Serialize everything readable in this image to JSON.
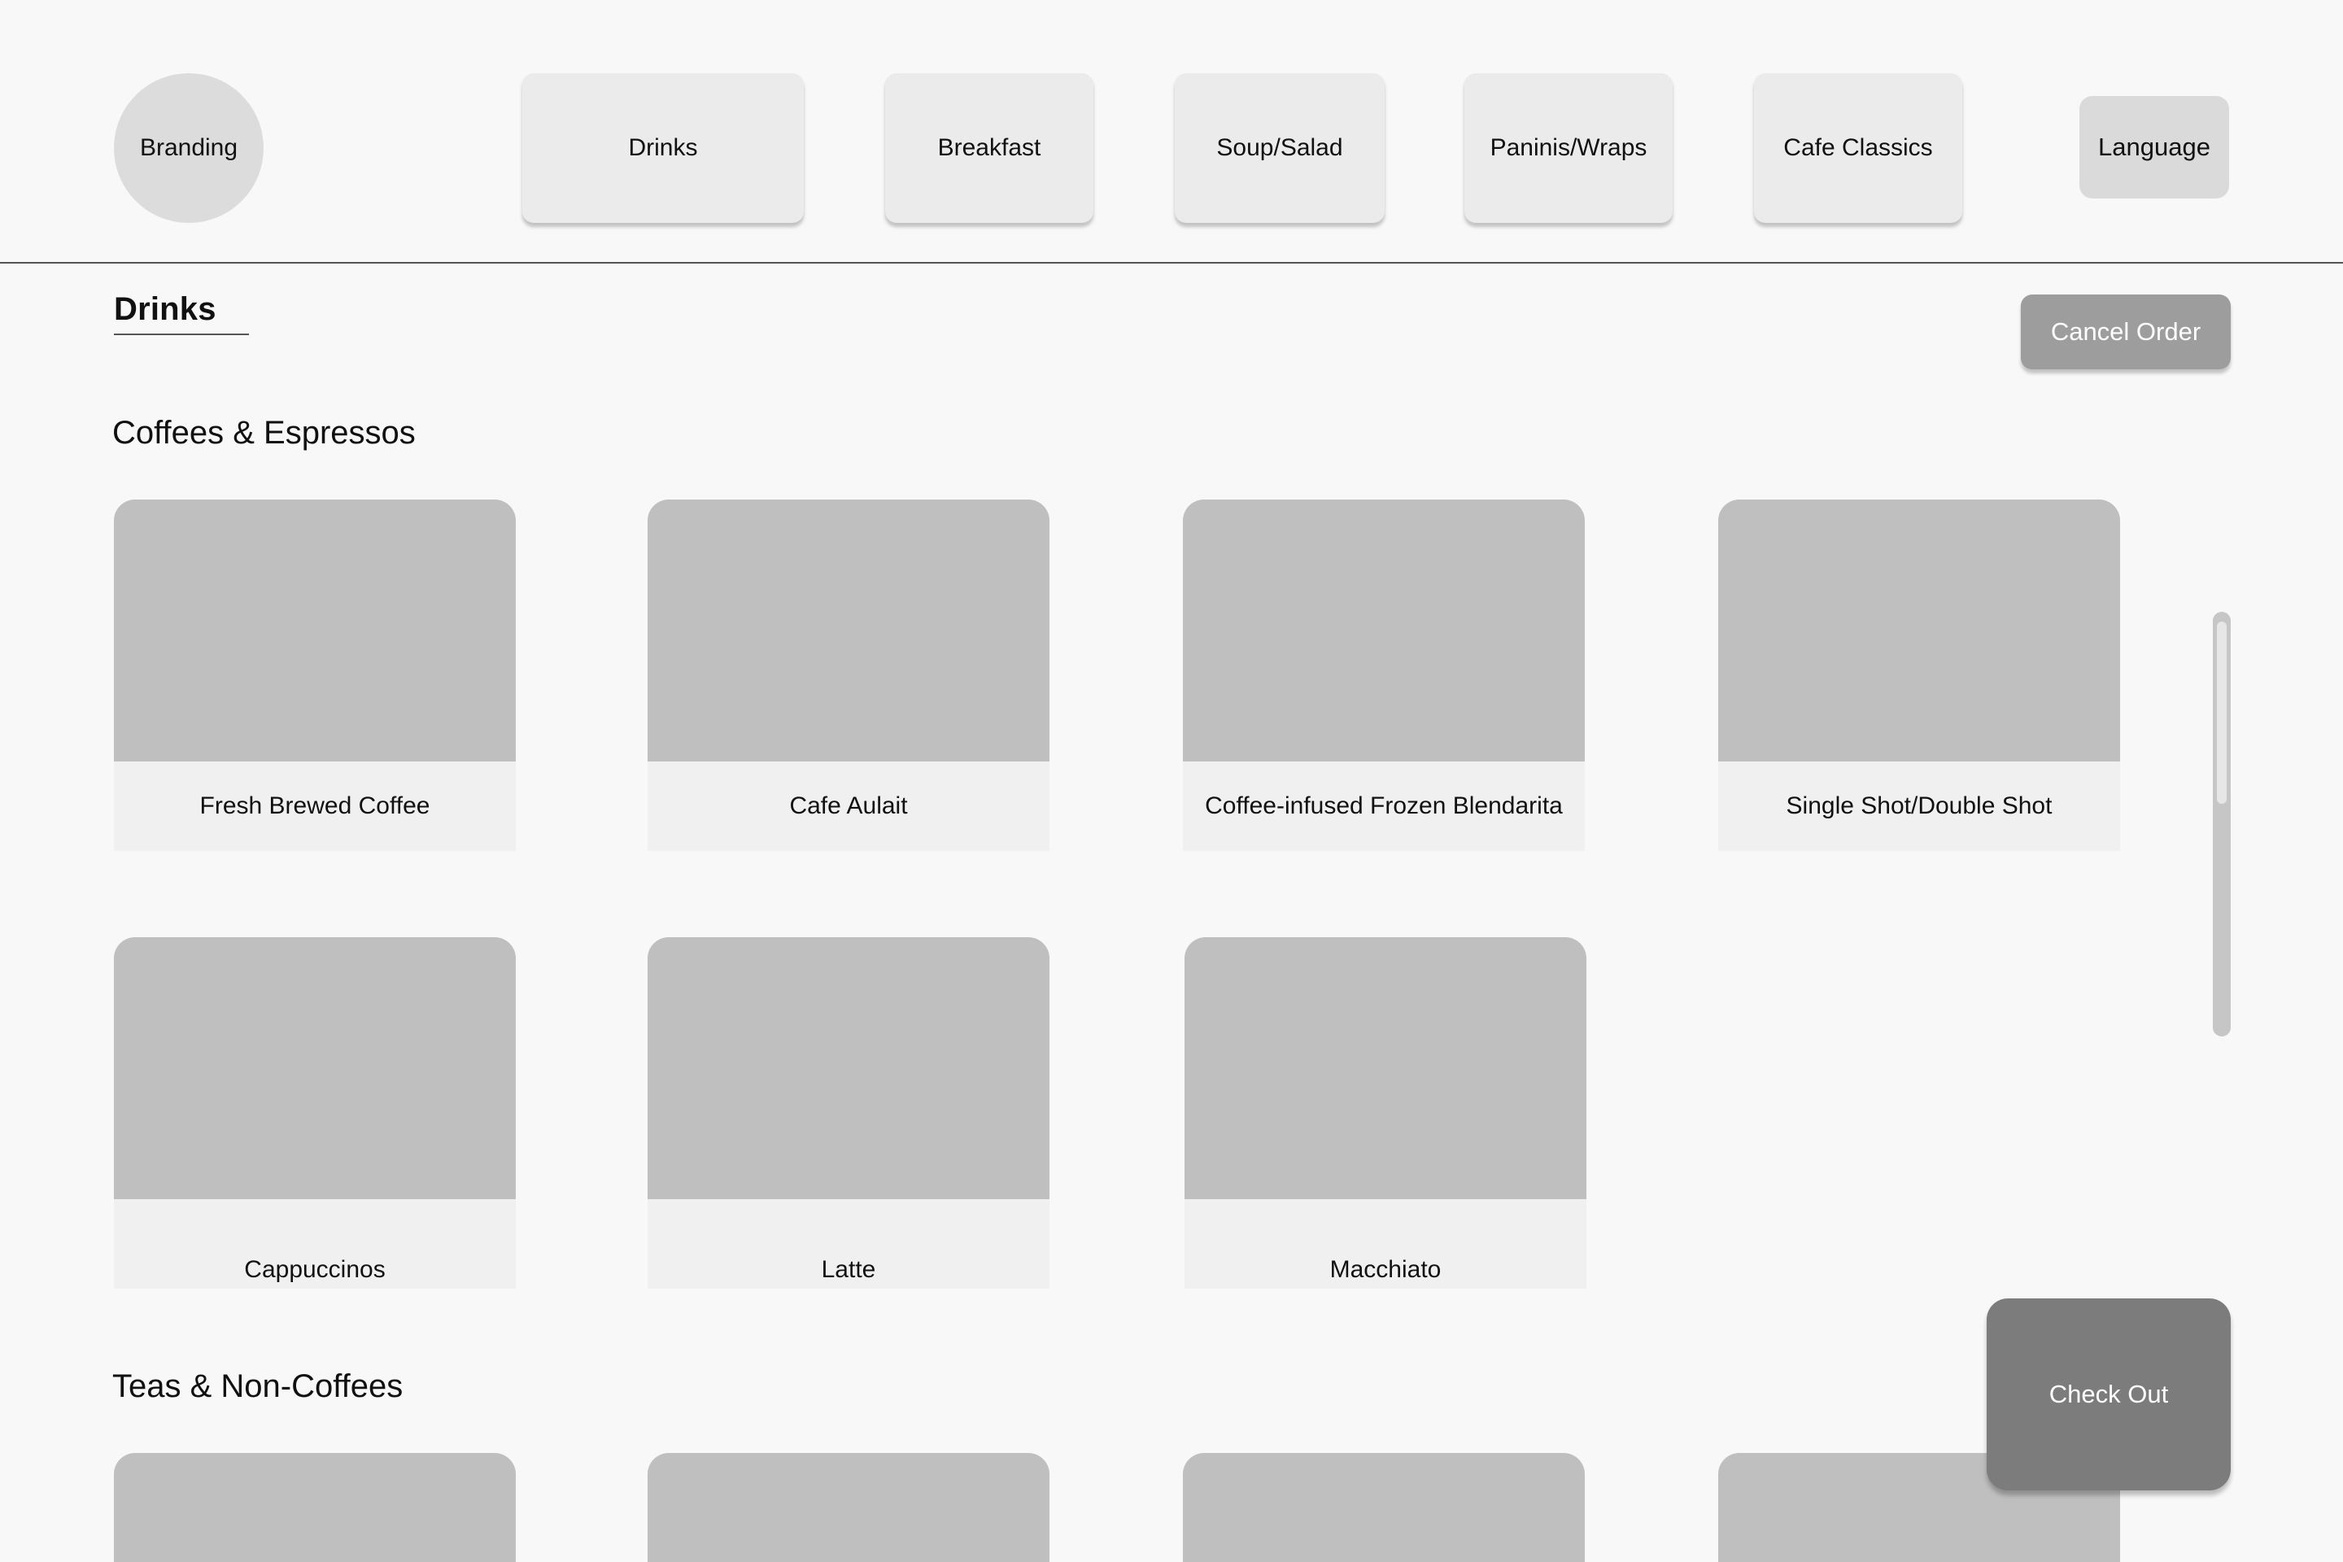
{
  "header": {
    "branding": "Branding",
    "tabs": [
      {
        "label": "Drinks"
      },
      {
        "label": "Breakfast"
      },
      {
        "label": "Soup/Salad"
      },
      {
        "label": "Paninis/Wraps"
      },
      {
        "label": "Cafe Classics"
      }
    ],
    "language_label": "Language"
  },
  "main": {
    "section_title": "Drinks",
    "cancel_label": "Cancel Order",
    "categories": [
      {
        "title": "Coffees & Espressos",
        "items": [
          {
            "label": "Fresh Brewed Coffee"
          },
          {
            "label": "Cafe Aulait"
          },
          {
            "label": "Coffee-infused Frozen Blendarita"
          },
          {
            "label": "Single Shot/Double Shot"
          },
          {
            "label": "Cappuccinos"
          },
          {
            "label": "Latte"
          },
          {
            "label": "Macchiato"
          }
        ]
      },
      {
        "title": "Teas & Non-Coffees",
        "items": []
      }
    ],
    "checkout_label": "Check Out"
  },
  "colors": {
    "background": "#f8f8f8",
    "tab": "#ebebeb",
    "image_placeholder": "#bfbfbf",
    "cancel_button": "#9d9d9d",
    "checkout_button": "#7c7c7c"
  }
}
